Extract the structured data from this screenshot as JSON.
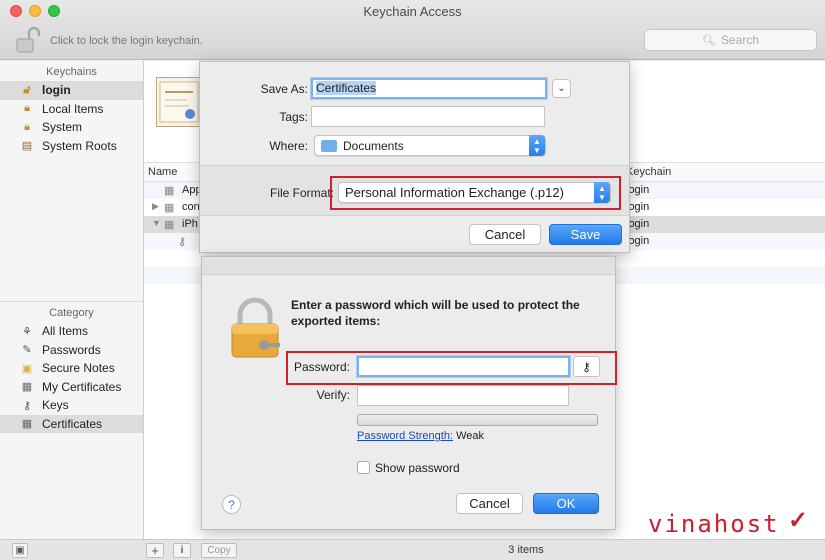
{
  "window": {
    "title": "Keychain Access",
    "lock_hint": "Click to lock the login keychain.",
    "search_placeholder": "Search"
  },
  "sidebar": {
    "keychains_header": "Keychains",
    "keychains": [
      {
        "label": "login",
        "icon": "open-lock-icon",
        "selected": true
      },
      {
        "label": "Local Items",
        "icon": "lock-icon"
      },
      {
        "label": "System",
        "icon": "lock-icon"
      },
      {
        "label": "System Roots",
        "icon": "cabinet-icon"
      }
    ],
    "category_header": "Category",
    "categories": [
      {
        "label": "All Items",
        "icon": "all-items-icon"
      },
      {
        "label": "Passwords",
        "icon": "pen-icon"
      },
      {
        "label": "Secure Notes",
        "icon": "note-icon"
      },
      {
        "label": "My Certificates",
        "icon": "certificate-icon"
      },
      {
        "label": "Keys",
        "icon": "key-icon"
      },
      {
        "label": "Certificates",
        "icon": "certificate-icon",
        "selected": true
      }
    ]
  },
  "list": {
    "columns": {
      "name": "Name",
      "keychain": "Keychain"
    },
    "rows": [
      {
        "name": "App",
        "keychain": "login"
      },
      {
        "name": "con",
        "keychain": "login"
      },
      {
        "name": "iPh",
        "keychain": "login"
      },
      {
        "name": "",
        "keychain": "login"
      }
    ]
  },
  "status_bar": {
    "add_label": "+",
    "info_label": "i",
    "copy_label": "Copy",
    "count": "3 items"
  },
  "save_sheet": {
    "save_as_label": "Save As:",
    "save_as_value": "Certificates",
    "tags_label": "Tags:",
    "tags_value": "",
    "where_label": "Where:",
    "where_value": "Documents",
    "file_format_label": "File Format:",
    "file_format_value": "Personal Information Exchange (.p12)",
    "cancel_label": "Cancel",
    "save_label": "Save"
  },
  "password_dialog": {
    "message": "Enter a password which will be used to protect the exported items:",
    "password_label": "Password:",
    "password_value": "",
    "verify_label": "Verify:",
    "verify_value": "",
    "strength_link": "Password Strength:",
    "strength_value": "Weak",
    "strength_fraction": 0,
    "show_password_label": "Show password",
    "help_label": "?",
    "cancel_label": "Cancel",
    "ok_label": "OK"
  },
  "watermark": {
    "text": "vinahost"
  },
  "colors": {
    "accent_blue": "#1f7ae9",
    "highlight_red": "#d0202e",
    "selection_gray": "#dcdcdc"
  }
}
